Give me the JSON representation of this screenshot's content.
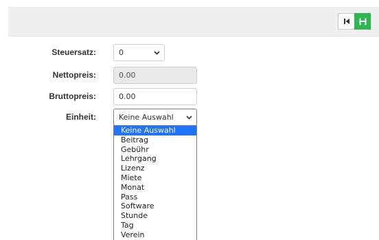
{
  "toolbar": {
    "first_icon": "skip-to-first-icon",
    "save_icon": "floppy-save-icon",
    "save_color": "#2fb552"
  },
  "form": {
    "tax_rate": {
      "label": "Steuersatz:",
      "value": "0"
    },
    "net_price": {
      "label": "Nettopreis:",
      "value": "0.00"
    },
    "gross_price": {
      "label": "Bruttopreis:",
      "value": "0.00"
    },
    "unit": {
      "label": "Einheit:",
      "value": "Keine Auswahl"
    }
  },
  "unit_dropdown": {
    "selected_index": 0,
    "selected_color": "#1e74ff",
    "options": [
      "Keine Auswahl",
      "Beitrag",
      "Gebühr",
      "Lehrgang",
      "Lizenz",
      "Miete",
      "Monat",
      "Pass",
      "Software",
      "Stunde",
      "Tag",
      "Verein"
    ]
  }
}
